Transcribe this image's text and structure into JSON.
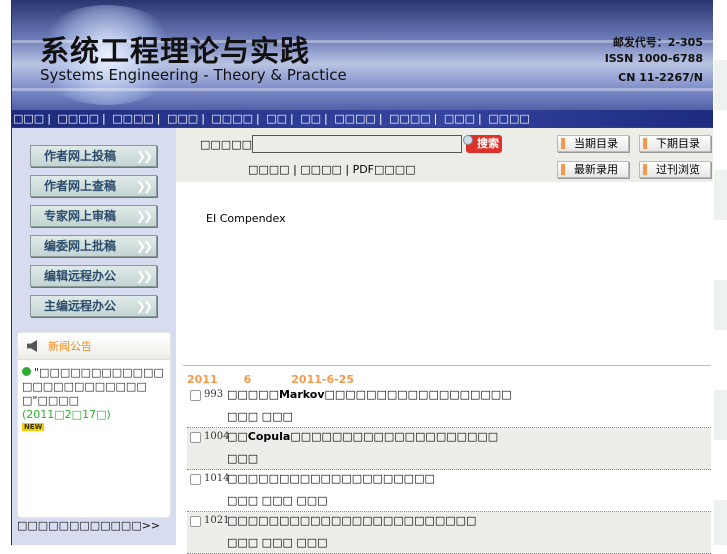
{
  "header": {
    "title_cn": "系统工程理论与实践",
    "title_en": "Systems Engineering - Theory & Practice",
    "postal_code": "邮发代号：2-305",
    "issn": "ISSN 1000-6788",
    "cn": "CN 11-2267/N"
  },
  "nav": [
    "□□□",
    "□□□□",
    "□□□□",
    "□□□",
    "□□□□",
    "□□",
    "□□",
    "□□□□",
    "□□□□",
    "□□□",
    "□□□□"
  ],
  "sidebar": {
    "buttons": [
      "作者网上投稿",
      "作者网上查稿",
      "专家网上审稿",
      "编委网上批稿",
      "编辑远程办公",
      "主编远程办公"
    ],
    "chevron": "❯❯",
    "news": {
      "title": "新闻公告",
      "item_text": "\"□□□□□□□□□□□□□□□□□□□□□□□□□\"□□□□",
      "item_date": "(2011□2□17□)",
      "badge": "NEW"
    },
    "more": "□□□□□□□□□□□□>>"
  },
  "search": {
    "label": "□□□□□□□",
    "value": "",
    "button": "搜索",
    "links": [
      "□□□□",
      "□□□□",
      "PDF□□□□"
    ]
  },
  "quick": [
    "当期目录",
    "下期目录",
    "最新录用",
    "过刊浏览"
  ],
  "index_text": "EI Compendex",
  "issue": {
    "year": "2011",
    "number": "6",
    "date": "2011-6-25"
  },
  "articles": [
    {
      "page": "993",
      "title": "□□□□□Markov□□□□□□□□□□□□□□□□□□",
      "authors": "□□□ □□□"
    },
    {
      "page": "1004",
      "title": "□□Copula□□□□□□□□□□□□□□□□□□□□",
      "authors": "□□□"
    },
    {
      "page": "1014",
      "title": "□□□□□□□□□□□□□□□□□□□□",
      "authors": "□□□ □□□ □□□"
    },
    {
      "page": "1021",
      "title": "□□□□□□□□□□□□□□□□□□□□□□□□",
      "authors": "□□□ □□□ □□□"
    }
  ]
}
